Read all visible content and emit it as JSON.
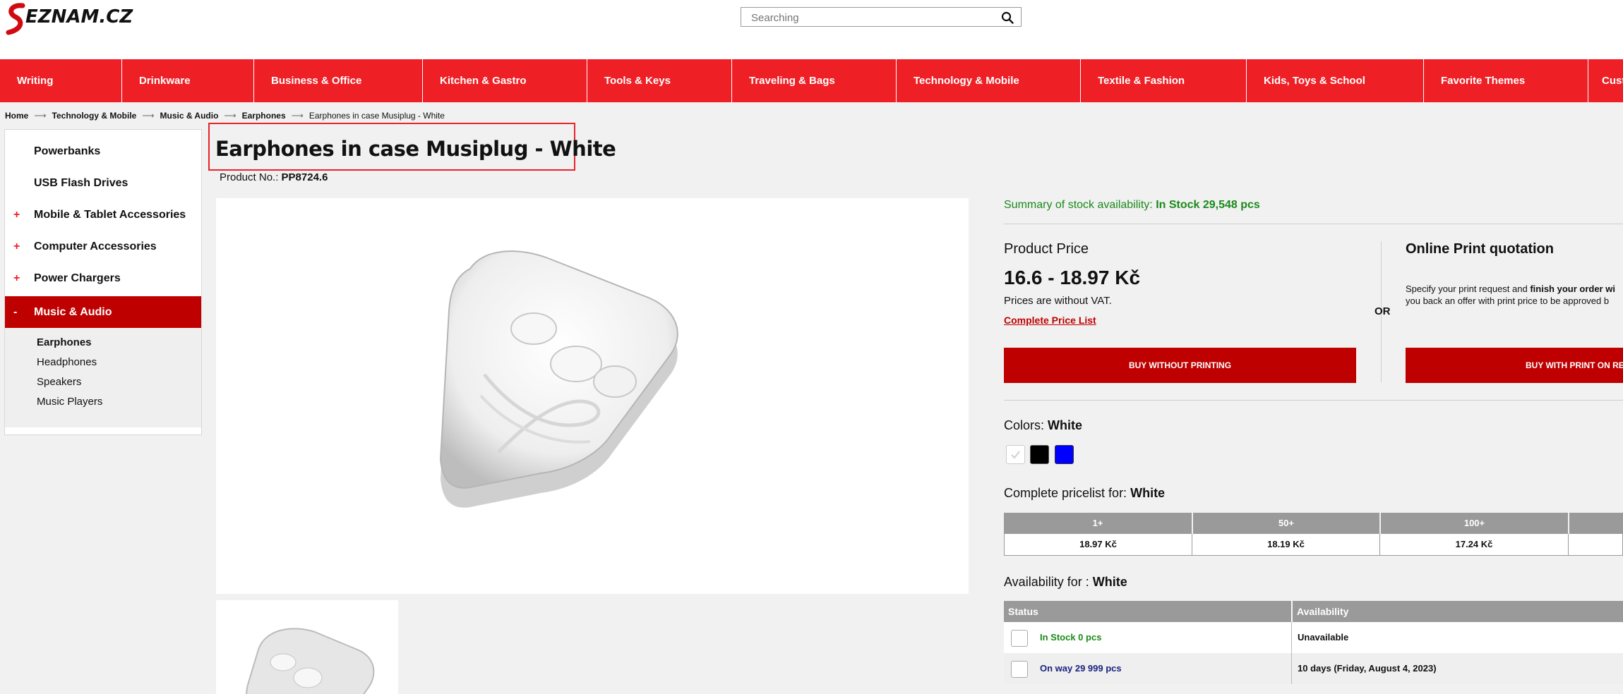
{
  "search": {
    "placeholder": "Searching"
  },
  "logo": {
    "text": "SEZNAM.CZ"
  },
  "nav": [
    "Writing",
    "Drinkware",
    "Business & Office",
    "Kitchen & Gastro",
    "Tools & Keys",
    "Traveling & Bags",
    "Technology & Mobile",
    "Textile & Fashion",
    "Kids, Toys & School",
    "Favorite Themes",
    "Cust"
  ],
  "breadcrumb": [
    "Home",
    "Technology & Mobile",
    "Music & Audio",
    "Earphones",
    "Earphones in case Musiplug - White"
  ],
  "sidebar": {
    "items": [
      {
        "label": "Powerbanks",
        "sign": ""
      },
      {
        "label": "USB Flash Drives",
        "sign": ""
      },
      {
        "label": "Mobile & Tablet Accessories",
        "sign": "+"
      },
      {
        "label": "Computer Accessories",
        "sign": "+"
      },
      {
        "label": "Power Chargers",
        "sign": "+"
      },
      {
        "label": "Music & Audio",
        "sign": "-"
      }
    ],
    "subitems": [
      "Earphones",
      "Headphones",
      "Speakers",
      "Music Players"
    ]
  },
  "product": {
    "title": "Earphones in case Musiplug - White",
    "number_label": "Product No.:",
    "number": "PP8724.6"
  },
  "stock": {
    "label": "Summary of stock availability:",
    "value": "In Stock 29,548 pcs"
  },
  "price": {
    "label": "Product Price",
    "value": "16.6 - 18.97 Kč",
    "vat_note": "Prices are without VAT.",
    "pricelist_link": "Complete Price List",
    "buy_button": "BUY WITHOUT PRINTING"
  },
  "or_label": "OR",
  "print": {
    "title": "Online Print quotation",
    "text_line1_start": "Specify your print request and ",
    "text_line1_bold": "finish your order wi",
    "text_line2": "you back an offer with print price to be approved b",
    "button": "BUY WITH PRINT ON REQU"
  },
  "colors": {
    "label": "Colors:",
    "selected": "White",
    "swatches": [
      "#ffffff",
      "#000000",
      "#0000ff"
    ]
  },
  "pricelist": {
    "label": "Complete pricelist for:",
    "color": "White",
    "headers": [
      "1+",
      "50+",
      "100+",
      ""
    ],
    "values": [
      "18.97 Kč",
      "18.19 Kč",
      "17.24 Kč",
      ""
    ]
  },
  "availability": {
    "label": "Availability for :",
    "color": "White",
    "headers": [
      "Status",
      "Availability"
    ],
    "rows": [
      {
        "status": "In Stock 0 pcs",
        "availability": "Unavailable",
        "status_color": "#1a8a1a"
      },
      {
        "status": "On way 29 999 pcs",
        "availability": "10 days (Friday, August 4, 2023)",
        "status_color": "#1a237e"
      }
    ]
  }
}
